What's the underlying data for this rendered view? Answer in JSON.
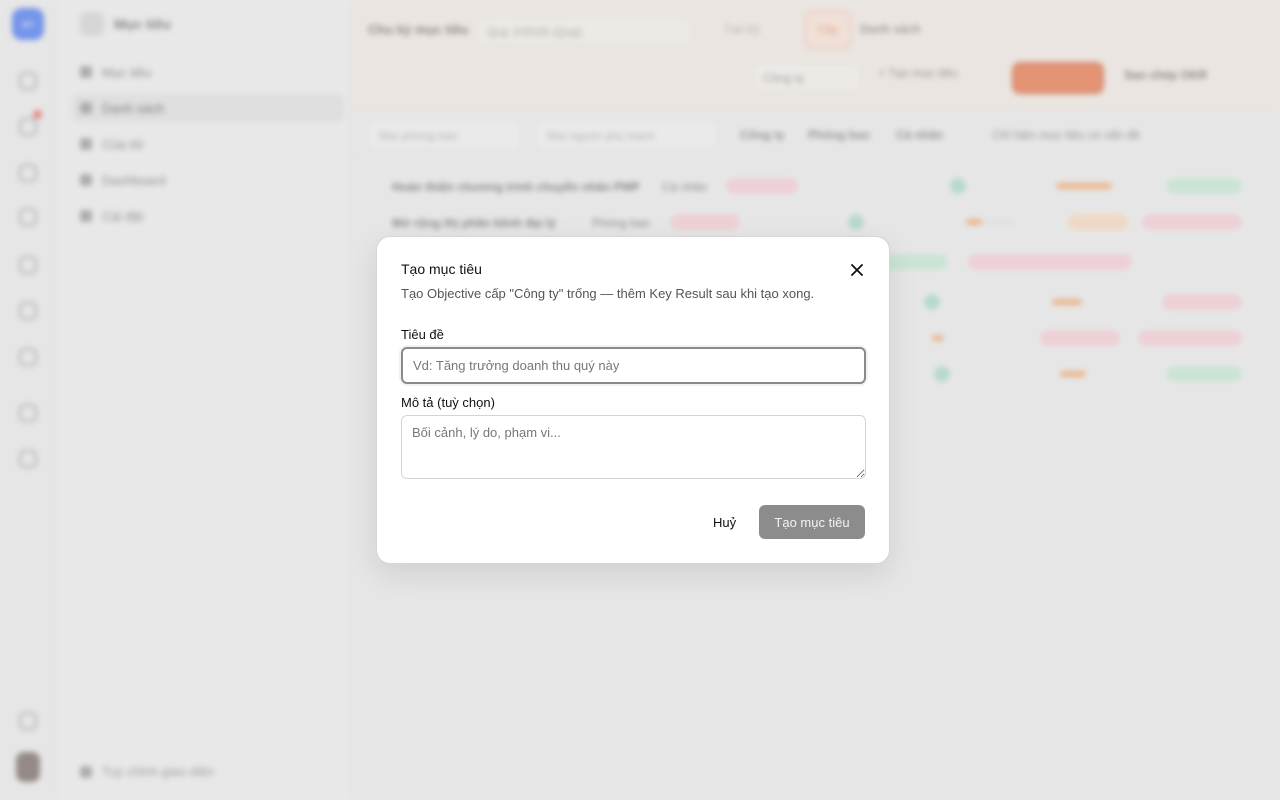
{
  "background": {
    "sidebar": {
      "title": "Mục tiêu",
      "items": [
        {
          "label": "Mục tiêu",
          "active": false
        },
        {
          "label": "Danh sách",
          "active": true
        },
        {
          "label": "Của tôi",
          "active": false
        },
        {
          "label": "Dashboard",
          "active": false
        },
        {
          "label": "Cài đặt",
          "active": false
        }
      ],
      "footer": "Tuỳ chỉnh giao diện"
    },
    "topbar": {
      "cycle_label": "Chu kỳ mục tiêu",
      "cycle_value": "Quý 2/2026 (Quý)",
      "link": "Tạo kỳ",
      "tab_active": "Cây",
      "tab_other": "Danh sách",
      "company_select": "Công ty",
      "create_link": "+ Tạo mục tiêu",
      "import_label": "Sao chép OKR"
    },
    "filters": {
      "dept_placeholder": "Mọi phòng ban",
      "owner_placeholder": "Mọi người phụ trách",
      "levels": [
        "Công ty",
        "Phòng ban",
        "Cá nhân"
      ],
      "toggle_label": "Chỉ hiện mục tiêu có vấn đề"
    },
    "rows": [
      {
        "title": "Hoàn thiện chương trình chuyển nhân PMP",
        "tag": "Cá nhân"
      },
      {
        "title": "Mở rộng thị phần kênh đại lý",
        "tag": "Phòng ban"
      }
    ],
    "accent_color": "#e56a3a"
  },
  "modal": {
    "title": "Tạo mục tiêu",
    "description": "Tạo Objective cấp \"Công ty\" trống — thêm Key Result sau khi tạo xong.",
    "title_field": {
      "label": "Tiêu đề",
      "placeholder": "Vd: Tăng trưởng doanh thu quý này",
      "value": ""
    },
    "description_field": {
      "label": "Mô tả (tuỳ chọn)",
      "placeholder": "Bối cảnh, lý do, phạm vi...",
      "value": ""
    },
    "cancel_label": "Huỷ",
    "submit_label": "Tạo mục tiêu",
    "close_icon": "close-icon"
  }
}
